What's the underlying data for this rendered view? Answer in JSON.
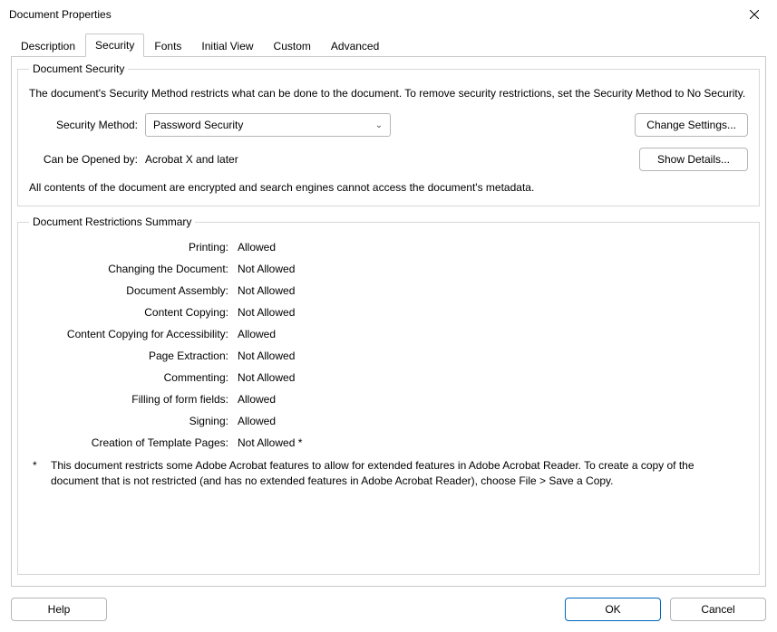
{
  "window": {
    "title": "Document Properties"
  },
  "tabs": {
    "description": "Description",
    "security": "Security",
    "fonts": "Fonts",
    "initial_view": "Initial View",
    "custom": "Custom",
    "advanced": "Advanced"
  },
  "security": {
    "group_title": "Document Security",
    "description": "The document's Security Method restricts what can be done to the document. To remove security restrictions, set the Security Method to No Security.",
    "method_label": "Security Method:",
    "method_value": "Password Security",
    "change_settings_btn": "Change Settings...",
    "opened_by_label": "Can be Opened by:",
    "opened_by_value": "Acrobat X and later",
    "show_details_btn": "Show Details...",
    "encryption_note": "All contents of the document are encrypted and search engines cannot access the document's metadata."
  },
  "restrictions": {
    "group_title": "Document Restrictions Summary",
    "items": [
      {
        "label": "Printing:",
        "value": "Allowed"
      },
      {
        "label": "Changing the Document:",
        "value": "Not Allowed"
      },
      {
        "label": "Document Assembly:",
        "value": "Not Allowed"
      },
      {
        "label": "Content Copying:",
        "value": "Not Allowed"
      },
      {
        "label": "Content Copying for Accessibility:",
        "value": "Allowed"
      },
      {
        "label": "Page Extraction:",
        "value": "Not Allowed"
      },
      {
        "label": "Commenting:",
        "value": "Not Allowed"
      },
      {
        "label": "Filling of form fields:",
        "value": "Allowed"
      },
      {
        "label": "Signing:",
        "value": "Allowed"
      },
      {
        "label": "Creation of Template Pages:",
        "value": "Not Allowed *"
      }
    ],
    "footnote_marker": "*",
    "footnote_text": "This document restricts some Adobe Acrobat features to allow for extended features in Adobe Acrobat Reader. To create a copy of the document that is not restricted (and has no extended features in Adobe Acrobat Reader), choose File > Save a Copy."
  },
  "footer": {
    "help": "Help",
    "ok": "OK",
    "cancel": "Cancel"
  }
}
